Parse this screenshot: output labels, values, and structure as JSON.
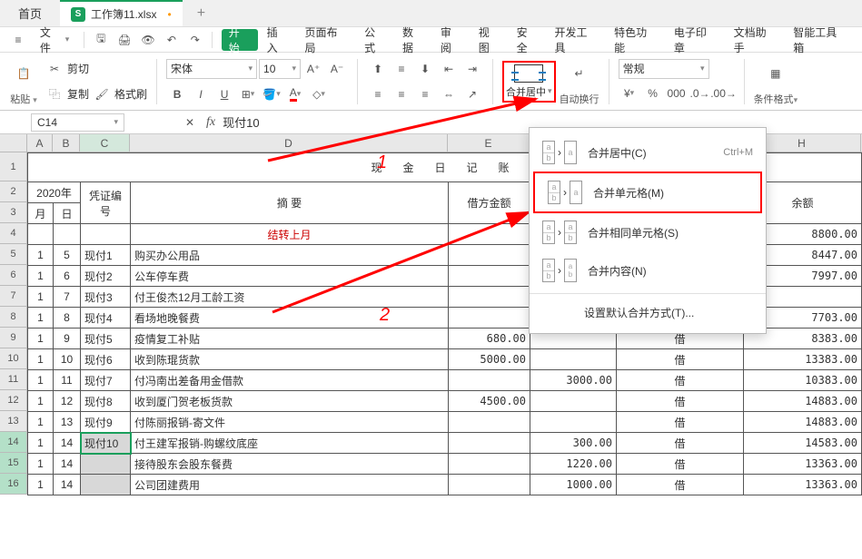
{
  "titlebar": {
    "home": "首页",
    "filename": "工作簿11.xlsx",
    "file_badge": "S"
  },
  "menu": {
    "file": "文件",
    "tabs": [
      "开始",
      "插入",
      "页面布局",
      "公式",
      "数据",
      "审阅",
      "视图",
      "安全",
      "开发工具",
      "特色功能",
      "电子印章",
      "文档助手",
      "智能工具箱"
    ]
  },
  "ribbon": {
    "paste": "粘贴",
    "cut": "剪切",
    "copy": "复制",
    "format_painter": "格式刷",
    "font_name": "宋体",
    "font_size": "10",
    "merge": "合并居中",
    "wrap": "自动换行",
    "number_format": "常规",
    "cond_format": "条件格式"
  },
  "dropdown": {
    "merge_center": "合并居中(C)",
    "merge_center_sc": "Ctrl+M",
    "merge_cells": "合并单元格(M)",
    "merge_same": "合并相同单元格(S)",
    "merge_content": "合并内容(N)",
    "default": "设置默认合并方式(T)..."
  },
  "formula": {
    "cell": "C14",
    "value": "现付10"
  },
  "cols": [
    "A",
    "B",
    "C",
    "D",
    "E",
    "",
    "",
    "H"
  ],
  "title": "现 金 日 记 账",
  "headers": {
    "year": "2020年",
    "month": "月",
    "day": "日",
    "voucher": "凭证编号",
    "summary": "摘    要",
    "lend_amt": "借方金额",
    "balance": "余额"
  },
  "carry": "结转上月",
  "rows": [
    {
      "m": "1",
      "d": "5",
      "v": "现付1",
      "s": "购买办公用品",
      "la": "",
      "ba": "8447.00"
    },
    {
      "m": "1",
      "d": "6",
      "v": "现付2",
      "s": "公车停车费",
      "la": "",
      "ba": "7997.00"
    },
    {
      "m": "1",
      "d": "7",
      "v": "现付3",
      "s": "付王俊杰12月工龄工资",
      "la": "",
      "ba": ""
    },
    {
      "m": "1",
      "d": "8",
      "v": "现付4",
      "s": "看场地晚餐费",
      "la": "",
      "ba": "7703.00"
    },
    {
      "m": "1",
      "d": "9",
      "v": "现付5",
      "s": "疫情复工补贴",
      "la": "680.00",
      "g": "借",
      "ba": "8383.00"
    },
    {
      "m": "1",
      "d": "10",
      "v": "现付6",
      "s": "收到陈琨货款",
      "la": "5000.00",
      "g": "借",
      "ba": "13383.00"
    },
    {
      "m": "1",
      "d": "11",
      "v": "现付7",
      "s": "付冯南出差备用金借款",
      "la": "",
      "f": "3000.00",
      "g": "借",
      "ba": "10383.00"
    },
    {
      "m": "1",
      "d": "12",
      "v": "现付8",
      "s": "收到厦门贺老板货款",
      "la": "4500.00",
      "g": "借",
      "ba": "14883.00"
    },
    {
      "m": "1",
      "d": "13",
      "v": "现付9",
      "s": "付陈丽报销-寄文件",
      "la": "",
      "g": "借",
      "ba": "14883.00"
    },
    {
      "m": "1",
      "d": "14",
      "v": "现付10",
      "s": "付王建军报销-购螺纹底座",
      "la": "",
      "f": "300.00",
      "g": "借",
      "ba": "14583.00"
    },
    {
      "m": "1",
      "d": "14",
      "v": "",
      "s": "接待股东会股东餐费",
      "la": "",
      "f": "1220.00",
      "g": "借",
      "ba": "13363.00"
    },
    {
      "m": "1",
      "d": "14",
      "v": "",
      "s": "公司团建费用",
      "la": "",
      "f": "1000.00",
      "g": "借",
      "ba": "13363.00"
    }
  ],
  "first_balance": "8800.00",
  "anno": {
    "a1": "1",
    "a2": "2"
  }
}
